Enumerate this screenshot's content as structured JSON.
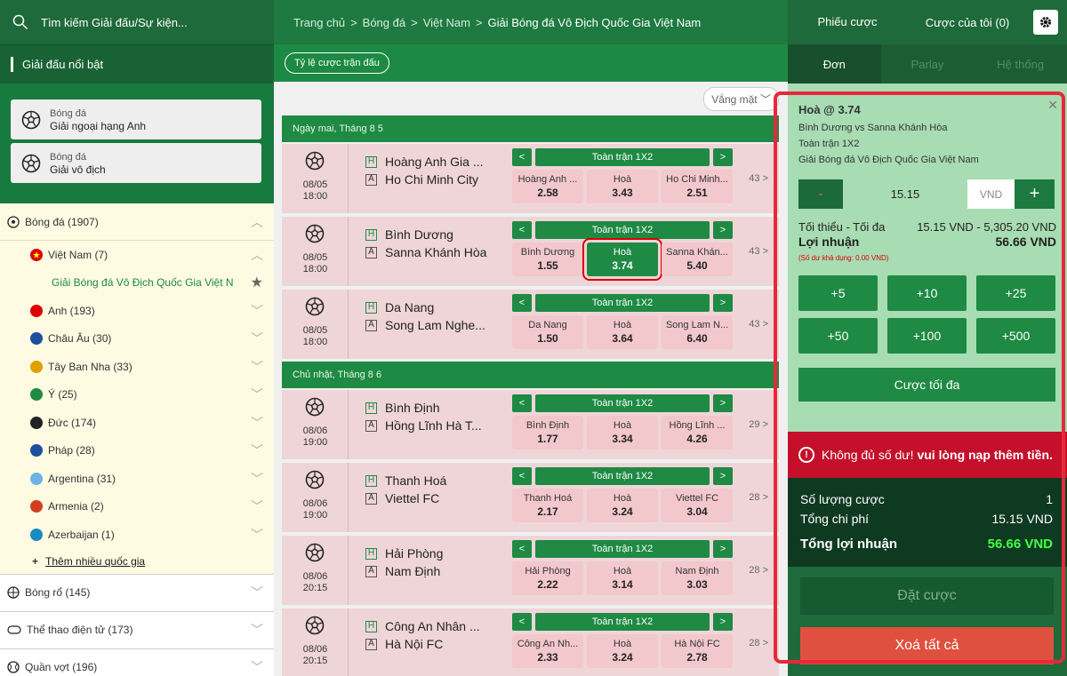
{
  "left": {
    "search_placeholder": "Tìm kiếm Giải đấu/Sự kiện...",
    "featured_title": "Giải đấu nổi bật",
    "featured": [
      {
        "sport": "Bóng đá",
        "name": "Giải ngoại hạng Anh"
      },
      {
        "sport": "Bóng đá",
        "name": "Giải vô địch"
      }
    ],
    "football": "Bóng đá (1907)",
    "vietnam": "Việt Nam (7)",
    "vn_league": "Giải Bóng đá Vô Địch Quốc Gia Việt N",
    "countries": [
      {
        "name": "Anh (193)",
        "color": "#d00"
      },
      {
        "name": "Châu Âu (30)",
        "color": "#1b4fa0"
      },
      {
        "name": "Tây Ban Nha (33)",
        "color": "#e0a000"
      },
      {
        "name": "Ý (25)",
        "color": "#1e8a44"
      },
      {
        "name": "Đức (174)",
        "color": "#222"
      },
      {
        "name": "Pháp (28)",
        "color": "#1b4fa0"
      },
      {
        "name": "Argentina (31)",
        "color": "#6ab4e8"
      },
      {
        "name": "Armenia (2)",
        "color": "#d04020"
      },
      {
        "name": "Azerbaijan (1)",
        "color": "#1b8ac0"
      }
    ],
    "more_countries": "Thêm nhiều quốc gia",
    "basketball": "Bóng rổ (145)",
    "esports": "Thể thao điện tử (173)",
    "tennis": "Quần vợt (196)"
  },
  "mid": {
    "breadcrumb": [
      "Trang chủ",
      "Bóng đá",
      "Việt Nam"
    ],
    "breadcrumb_current": "Giải Bóng đá Vô Địch Quốc Gia Việt Nam",
    "odds_button": "Tỷ lệ cược trận đấu",
    "absent_select": "Vắng mặt",
    "day1": "Ngày mai, Tháng 8 5",
    "day2": "Chủ nhật, Tháng 8 6",
    "market_title": "Toàn trận 1X2",
    "matches": [
      {
        "date": "08/05",
        "time": "18:00",
        "home": "Hoàng Anh Gia ...",
        "away": "Ho Chi Minh City",
        "o1n": "Hoàng Anh ...",
        "o1": "2.58",
        "oxn": "Hoà",
        "ox": "3.43",
        "o2n": "Ho Chi Minh...",
        "o2": "2.51",
        "count": "43 >"
      },
      {
        "date": "08/05",
        "time": "18:00",
        "home": "Bình Dương",
        "away": "Sanna Khánh Hòa",
        "o1n": "Bình Dương",
        "o1": "1.55",
        "oxn": "Hoà",
        "ox": "3.74",
        "o2n": "Sanna Khán...",
        "o2": "5.40",
        "count": "43 >"
      },
      {
        "date": "08/05",
        "time": "18:00",
        "home": "Da Nang",
        "away": "Song Lam Nghe...",
        "o1n": "Da Nang",
        "o1": "1.50",
        "oxn": "Hoà",
        "ox": "3.64",
        "o2n": "Song Lam N...",
        "o2": "6.40",
        "count": "43 >"
      },
      {
        "date": "08/06",
        "time": "19:00",
        "home": "Bình Định",
        "away": "Hồng Lĩnh Hà T...",
        "o1n": "Bình Định",
        "o1": "1.77",
        "oxn": "Hoà",
        "ox": "3.34",
        "o2n": "Hồng Lĩnh ...",
        "o2": "4.26",
        "count": "29 >"
      },
      {
        "date": "08/06",
        "time": "19:00",
        "home": "Thanh Hoá",
        "away": "Viettel FC",
        "o1n": "Thanh Hoá",
        "o1": "2.17",
        "oxn": "Hoà",
        "ox": "3.24",
        "o2n": "Viettel FC",
        "o2": "3.04",
        "count": "28 >"
      },
      {
        "date": "08/06",
        "time": "20:15",
        "home": "Hải Phòng",
        "away": "Nam Định",
        "o1n": "Hải Phòng",
        "o1": "2.22",
        "oxn": "Hoà",
        "ox": "3.14",
        "o2n": "Nam Định",
        "o2": "3.03",
        "count": "28 >"
      },
      {
        "date": "08/06",
        "time": "20:15",
        "home": "Công An Nhân ...",
        "away": "Hà Nội FC",
        "o1n": "Công An Nh...",
        "o1": "2.33",
        "oxn": "Hoà",
        "ox": "3.24",
        "o2n": "Hà Nội FC",
        "o2": "2.78",
        "count": "28 >"
      }
    ]
  },
  "right": {
    "tab_slip": "Phiếu cược",
    "tab_mybets": "Cược của tôi (0)",
    "sub_single": "Đơn",
    "sub_parlay": "Parlay",
    "sub_system": "Hệ thống",
    "sel_title": "Hoà @ 3.74",
    "sel_match": "Bình Dương vs Sanna Khánh Hòa",
    "sel_market": "Toàn trận 1X2",
    "sel_league": "Giải Bóng đá Vô Địch Quốc Gia Việt Nam",
    "stake_minus": "-",
    "stake_value": "15.15",
    "currency": "VND",
    "stake_plus": "+",
    "minmax_label": "Tối thiểu - Tối đa",
    "minmax_value": "15.15 VND - 5,305.20 VND",
    "profit_label": "Lợi nhuận",
    "profit_value": "56.66 VND",
    "available": "(Số dư khả dụng: 0.00 VND)",
    "quick": [
      "+5",
      "+10",
      "+25",
      "+50",
      "+100",
      "+500"
    ],
    "max_bet": "Cược tối đa",
    "warning": "Không đủ số dư!",
    "warning_bold": "vui lòng nạp thêm tiền.",
    "count_label": "Số lượng cược",
    "count_value": "1",
    "cost_label": "Tổng chi phí",
    "cost_value": "15.15 VND",
    "total_label": "Tổng lợi nhuận",
    "total_value": "56.66 VND",
    "place_bet": "Đặt cược",
    "clear_all": "Xoá tất cả"
  }
}
